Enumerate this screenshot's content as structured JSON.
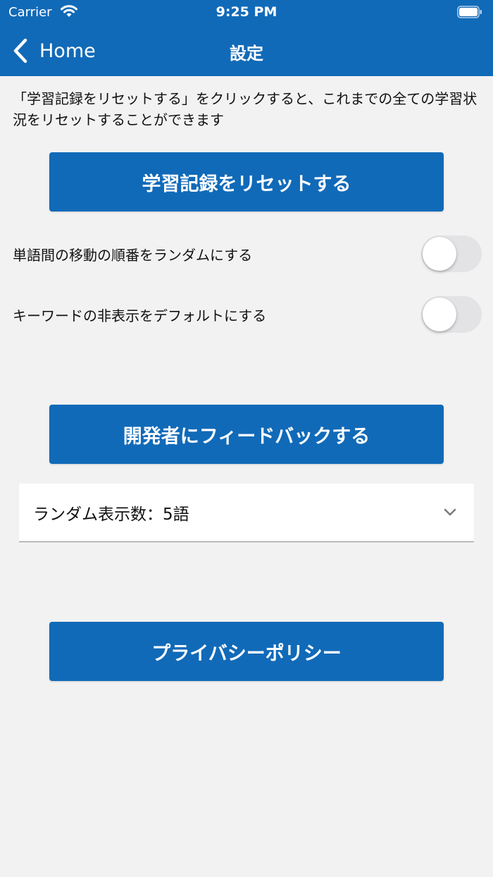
{
  "status_bar": {
    "carrier": "Carrier",
    "time": "9:25 PM"
  },
  "nav": {
    "back_label": "Home",
    "title": "設定"
  },
  "description": "「学習記録をリセットする」をクリックすると、これまでの全ての学習状況をリセットすることができます",
  "buttons": {
    "reset": "学習記録をリセットする",
    "feedback": "開発者にフィードバックする",
    "privacy": "プライバシーポリシー"
  },
  "toggles": [
    {
      "label": "単語間の移動の順番をランダムにする",
      "on": false
    },
    {
      "label": "キーワードの非表示をデフォルトにする",
      "on": false
    }
  ],
  "random_count_select": {
    "value": "ランダム表示数：5語"
  },
  "colors": {
    "accent": "#116ab8",
    "background": "#f2f2f2",
    "switch_off": "#e3e3e6"
  }
}
